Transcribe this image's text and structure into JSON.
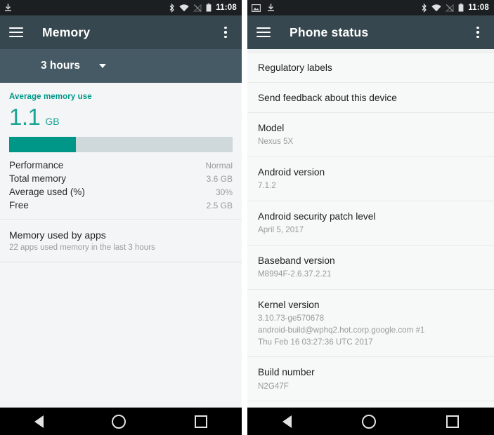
{
  "left": {
    "status_bar": {
      "left_icons": [
        "download-icon"
      ],
      "right_icons": [
        "bluetooth-icon",
        "wifi-icon",
        "signal-off-icon",
        "battery-icon"
      ],
      "clock": "11:08"
    },
    "toolbar": {
      "menu_icon": "hamburger-icon",
      "title": "Memory",
      "overflow_icon": "kebab-icon"
    },
    "spinner": {
      "label": "3 hours",
      "caret_icon": "chevron-down-icon"
    },
    "memory_card": {
      "caption": "Average memory use",
      "value": "1.1",
      "unit": "GB",
      "bar_percent": 30,
      "stats": [
        {
          "key": "Performance",
          "value": "Normal"
        },
        {
          "key": "Total memory",
          "value": "3.6 GB"
        },
        {
          "key": "Average used (%)",
          "value": "30%"
        },
        {
          "key": "Free",
          "value": "2.5 GB"
        }
      ]
    },
    "apps_card": {
      "title": "Memory used by apps",
      "subtitle": "22 apps used memory in the last 3 hours"
    },
    "nav_bar": {
      "back": "back-icon",
      "home": "home-icon",
      "recents": "recents-icon"
    }
  },
  "right": {
    "status_bar": {
      "left_icons": [
        "screenshot-icon",
        "download-icon"
      ],
      "right_icons": [
        "bluetooth-icon",
        "wifi-icon",
        "signal-off-icon",
        "battery-icon"
      ],
      "clock": "11:08"
    },
    "toolbar": {
      "menu_icon": "hamburger-icon",
      "title": "Phone status",
      "overflow_icon": "kebab-icon"
    },
    "items": [
      {
        "title": "Regulatory labels",
        "subtitle": ""
      },
      {
        "title": "Send feedback about this device",
        "subtitle": ""
      },
      {
        "title": "Model",
        "subtitle": "Nexus 5X"
      },
      {
        "title": "Android version",
        "subtitle": "7.1.2"
      },
      {
        "title": "Android security patch level",
        "subtitle": "April 5, 2017"
      },
      {
        "title": "Baseband version",
        "subtitle": "M8994F-2.6.37.2.21"
      },
      {
        "title": "Kernel version",
        "subtitle": "3.10.73-ge570678\nandroid-build@wphq2.hot.corp.google.com #1\nThu Feb 16 03:27:36 UTC 2017"
      },
      {
        "title": "Build number",
        "subtitle": "N2G47F"
      }
    ],
    "nav_bar": {
      "back": "back-icon",
      "home": "home-icon",
      "recents": "recents-icon"
    }
  },
  "colors": {
    "accent_teal": "#009688",
    "toolbar": "#37474f",
    "spinner_row": "#455a64",
    "status_bar": "#1b1f22"
  }
}
